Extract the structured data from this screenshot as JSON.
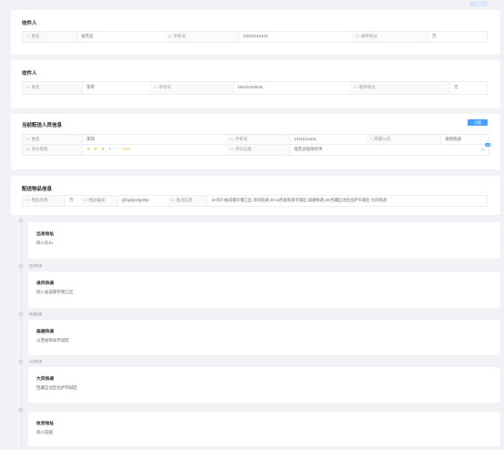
{
  "top_button": "提交",
  "sender": {
    "title": "收件人",
    "name_label": "姓名",
    "name": "张无忌",
    "phone_label": "手机号",
    "phone": "13222242424",
    "city_label": "收件地址",
    "city": "万"
  },
  "receiver": {
    "title": "收件人",
    "name_label": "姓名",
    "name": "李苹",
    "phone_label": "手机号",
    "phone": "15423434543",
    "city_label": "收件地址",
    "city": "万"
  },
  "courier": {
    "title": "当前配送人员信息",
    "button": "详情",
    "name_label": "姓名",
    "name": "李四",
    "phone_label": "手机号",
    "phone": "13111111111",
    "company_label": "所属公司",
    "company": "进风快递",
    "rating_label": "评价等级",
    "rating_value": "3.54",
    "rating_stars": 3.5,
    "review_label": "评价信息",
    "review": "张无忌给你好评",
    "chat_count": "12",
    "colors": {
      "accent": "#409eff",
      "star": "#f7ba2a"
    }
  },
  "goods": {
    "title": "配送物品信息",
    "weight_label": "物品名称",
    "weight": "万",
    "order_label": "物品编号",
    "order": "gfCgdy1QpWp",
    "route_label": "备注信息",
    "route": "1¥-四川省成都市锦江区-进风快递,2¥-山西省阳泉市城区-扁通快递,2¥-西藏自治区拉萨市城区-大风快递"
  },
  "timeline": [
    {
      "time": "",
      "title": "出发地址",
      "sub": "四川乐山"
    },
    {
      "time": "进风快递",
      "title": "进风快递",
      "sub": "四川省成都市锦江区"
    },
    {
      "time": "扁通快递",
      "title": "扁通快递",
      "sub": "山西省阳泉市城区"
    },
    {
      "time": "大风快递",
      "title": "大风快递",
      "sub": "西藏自治区拉萨市城区"
    },
    {
      "time": "",
      "title": "收货地址",
      "sub": "四川成都"
    }
  ]
}
